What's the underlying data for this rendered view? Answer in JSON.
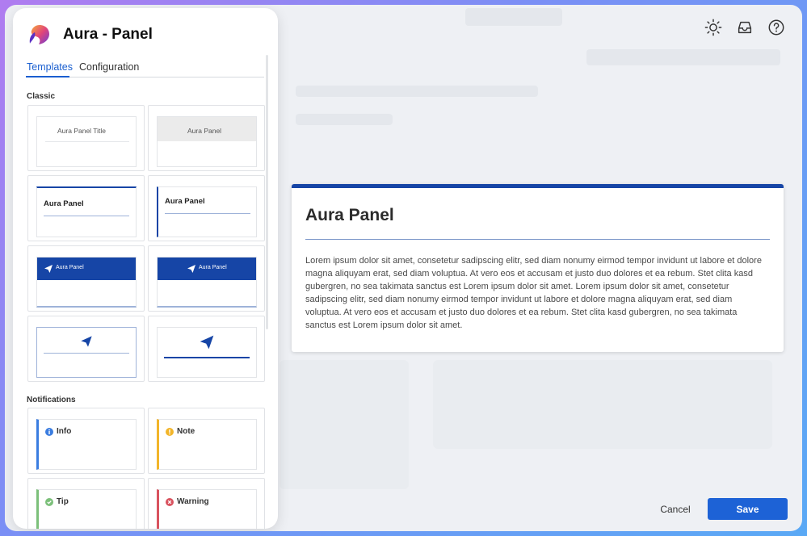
{
  "panel": {
    "title": "Aura - Panel",
    "tabs": [
      {
        "label": "Templates",
        "active": true
      },
      {
        "label": "Configuration",
        "active": false
      }
    ]
  },
  "sections": {
    "classic": "Classic",
    "notifications": "Notifications"
  },
  "templates": {
    "t1": "Aura Panel Title",
    "t2": "Aura Panel",
    "t3": "Aura Panel",
    "t4": "Aura Panel",
    "t5": "Aura Panel",
    "t6": "Aura Panel"
  },
  "notifications": {
    "info": "Info",
    "note": "Note",
    "tip": "Tip",
    "warning": "Warning"
  },
  "preview": {
    "title": "Aura Panel",
    "body": "Lorem ipsum dolor sit amet, consetetur sadipscing elitr, sed diam nonumy eirmod tempor invidunt ut labore et dolore magna aliquyam erat, sed diam voluptua. At vero eos et accusam et justo duo dolores et ea rebum. Stet clita kasd gubergren, no sea takimata sanctus est Lorem ipsum dolor sit amet. Lorem ipsum dolor sit amet, consetetur sadipscing elitr, sed diam nonumy eirmod tempor invidunt ut labore et dolore magna aliquyam erat, sed diam voluptua. At vero eos et accusam et justo duo dolores et ea rebum. Stet clita kasd gubergren, no sea takimata sanctus est Lorem ipsum dolor sit amet."
  },
  "actions": {
    "cancel": "Cancel",
    "save": "Save"
  },
  "icons": [
    "sun-icon",
    "inbox-icon",
    "help-icon",
    "paper-plane-icon",
    "info-icon",
    "note-icon",
    "tip-icon",
    "warning-icon"
  ],
  "colors": {
    "accent": "#1d62d6",
    "panel_border": "#1645a6",
    "info": "#3b7de0",
    "note": "#f2b52a",
    "tip": "#7cc07a",
    "warning": "#d9535f"
  }
}
